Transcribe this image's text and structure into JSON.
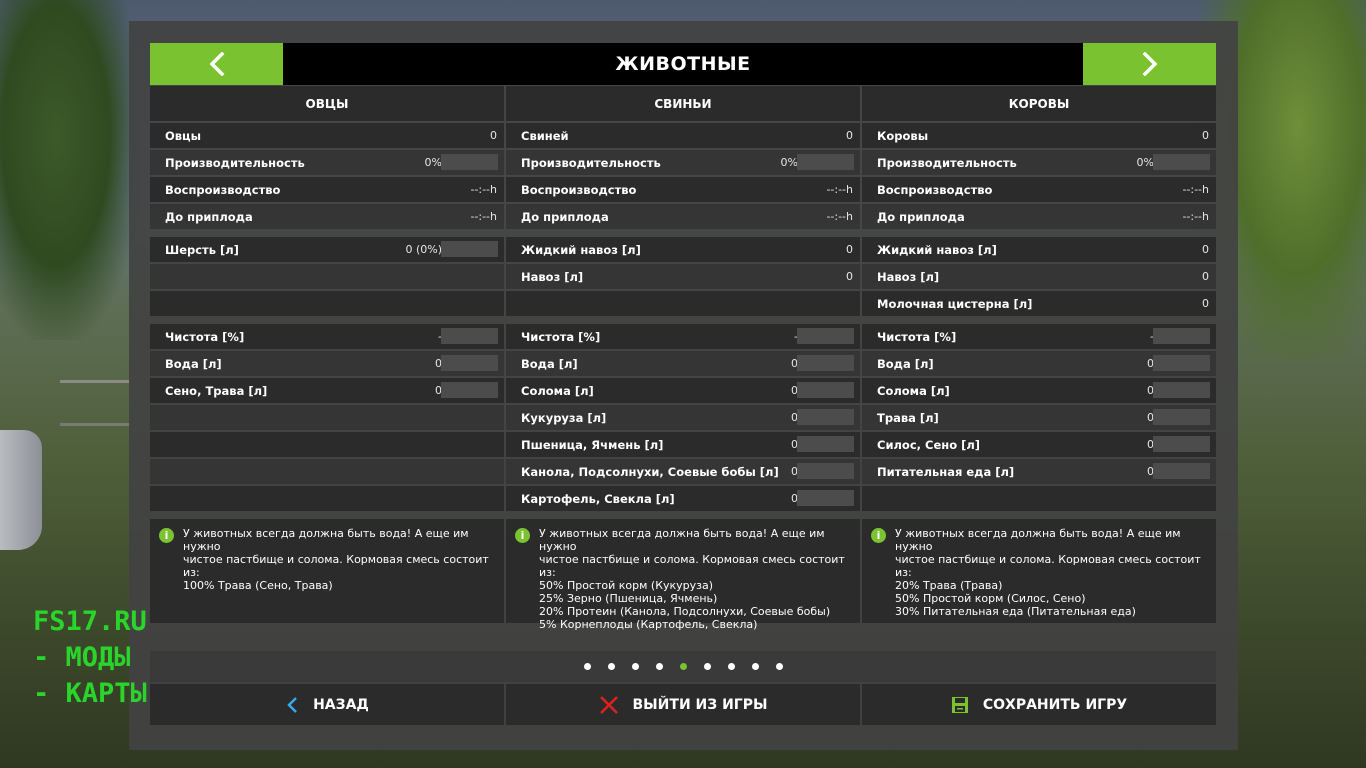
{
  "header": {
    "title": "ЖИВОТНЫЕ",
    "prev_label": "<",
    "next_label": ">"
  },
  "columns": [
    {
      "title": "ОВЦЫ",
      "stats": [
        {
          "label": "Овцы",
          "value": "0",
          "bar": false
        },
        {
          "label": "Производительность",
          "value": "0%",
          "bar": true
        },
        {
          "label": "Воспроизводство",
          "value": "--:--h",
          "bar": false
        },
        {
          "label": "До приплода",
          "value": "--:--h",
          "bar": false
        }
      ],
      "products": [
        {
          "label": "Шерсть [л]",
          "value": "0 (0%)",
          "bar": true
        },
        {
          "label": "",
          "value": "",
          "bar": false
        },
        {
          "label": "",
          "value": "",
          "bar": false
        }
      ],
      "needs": [
        {
          "label": "Чистота [%]",
          "value": "-",
          "bar": true
        },
        {
          "label": "Вода [л]",
          "value": "0",
          "bar": true
        },
        {
          "label": "Сено, Трава [л]",
          "value": "0",
          "bar": true
        },
        {
          "label": "",
          "value": "",
          "bar": false
        },
        {
          "label": "",
          "value": "",
          "bar": false
        },
        {
          "label": "",
          "value": "",
          "bar": false
        },
        {
          "label": "",
          "value": "",
          "bar": false
        }
      ],
      "info": "У животных всегда должна быть вода! А еще им нужно\nчистое пастбище и солома. Кормовая смесь состоит\nиз:\n100% Трава (Сено, Трава)"
    },
    {
      "title": "СВИНЬИ",
      "stats": [
        {
          "label": "Свиней",
          "value": "0",
          "bar": false
        },
        {
          "label": "Производительность",
          "value": "0%",
          "bar": true
        },
        {
          "label": "Воспроизводство",
          "value": "--:--h",
          "bar": false
        },
        {
          "label": "До приплода",
          "value": "--:--h",
          "bar": false
        }
      ],
      "products": [
        {
          "label": "Жидкий навоз [л]",
          "value": "0",
          "bar": false
        },
        {
          "label": "Навоз [л]",
          "value": "0",
          "bar": false
        },
        {
          "label": "",
          "value": "",
          "bar": false
        }
      ],
      "needs": [
        {
          "label": "Чистота [%]",
          "value": "-",
          "bar": true
        },
        {
          "label": "Вода [л]",
          "value": "0",
          "bar": true
        },
        {
          "label": "Солома [л]",
          "value": "0",
          "bar": true
        },
        {
          "label": "Кукуруза [л]",
          "value": "0",
          "bar": true
        },
        {
          "label": "Пшеница, Ячмень [л]",
          "value": "0",
          "bar": true
        },
        {
          "label": "Канола, Подсолнухи, Соевые бобы [л]",
          "value": "0",
          "bar": true
        },
        {
          "label": "Картофель, Свекла [л]",
          "value": "0",
          "bar": true
        }
      ],
      "info": "У животных всегда должна быть вода! А еще им нужно\nчистое пастбище и солома. Кормовая смесь состоит\nиз:\n50% Простой корм (Кукуруза)\n25% Зерно (Пшеница, Ячмень)\n20% Протеин (Канола, Подсолнухи, Соевые бобы)\n5% Корнеплоды (Картофель, Свекла)"
    },
    {
      "title": "КОРОВЫ",
      "stats": [
        {
          "label": "Коровы",
          "value": "0",
          "bar": false
        },
        {
          "label": "Производительность",
          "value": "0%",
          "bar": true
        },
        {
          "label": "Воспроизводство",
          "value": "--:--h",
          "bar": false
        },
        {
          "label": "До приплода",
          "value": "--:--h",
          "bar": false
        }
      ],
      "products": [
        {
          "label": "Жидкий навоз [л]",
          "value": "0",
          "bar": false
        },
        {
          "label": "Навоз [л]",
          "value": "0",
          "bar": false
        },
        {
          "label": "Молочная цистерна [л]",
          "value": "0",
          "bar": false
        }
      ],
      "needs": [
        {
          "label": "Чистота [%]",
          "value": "-",
          "bar": true
        },
        {
          "label": "Вода [л]",
          "value": "0",
          "bar": true
        },
        {
          "label": "Солома [л]",
          "value": "0",
          "bar": true
        },
        {
          "label": "Трава [л]",
          "value": "0",
          "bar": true
        },
        {
          "label": "Силос, Сено [л]",
          "value": "0",
          "bar": true
        },
        {
          "label": "Питательная еда [л]",
          "value": "0",
          "bar": true
        },
        {
          "label": "",
          "value": "",
          "bar": false
        }
      ],
      "info": "У животных всегда должна быть вода! А еще им нужно\nчистое пастбище и солома. Кормовая смесь состоит\nиз:\n20% Трава (Трава)\n50% Простой корм (Силос, Сено)\n30% Питательная еда (Питательная еда)"
    }
  ],
  "pagination": {
    "count": 9,
    "active_index": 4
  },
  "footer": {
    "back_label": "НАЗАД",
    "quit_label": "ВЫЙТИ ИЗ ИГРЫ",
    "save_label": "СОХРАНИТЬ ИГРУ"
  },
  "watermark": [
    "FS17.RU",
    "- МОДЫ",
    "- КАРТЫ"
  ],
  "colors": {
    "accent": "#7ac230",
    "panel": "#424242",
    "row_dark": "#2b2b2b",
    "row_light": "#353535",
    "quit_icon": "#e0201c",
    "back_icon": "#3aa8e8",
    "watermark": "#2bd42b"
  },
  "icons": {
    "prev": "chevron-left-icon",
    "next": "chevron-right-icon",
    "info": "info-icon",
    "back": "chevron-left-icon",
    "quit": "close-icon",
    "save": "floppy-disk-icon"
  }
}
